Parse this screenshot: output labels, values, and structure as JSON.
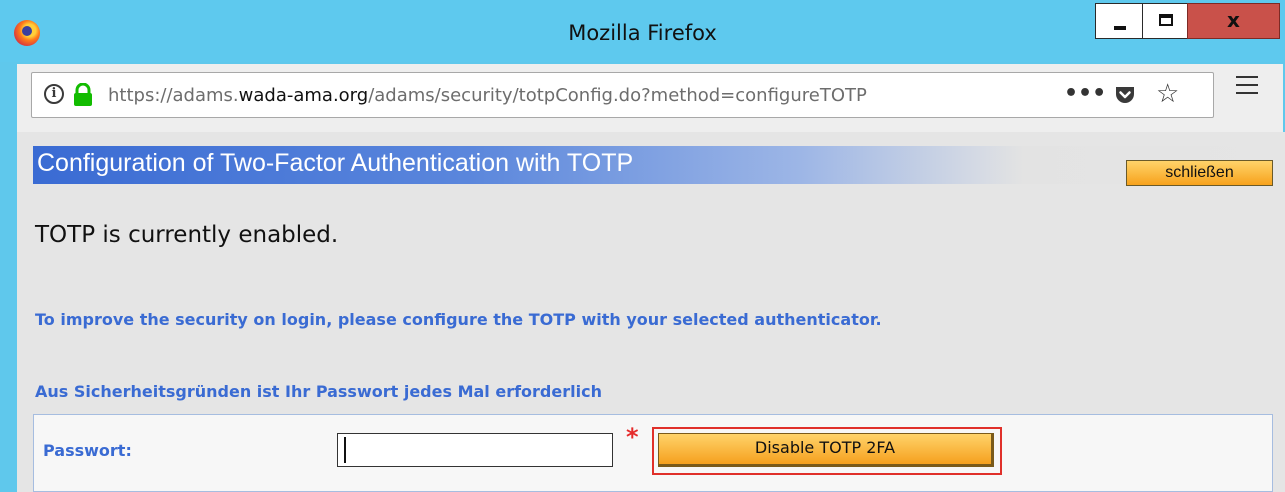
{
  "window": {
    "title": "Mozilla Firefox",
    "minimize_glyph": "",
    "close_glyph": "x"
  },
  "browser": {
    "url_prefix": "https://adams.",
    "url_domain": "wada-ama.org",
    "url_suffix": "/adams/security/totpConfig.do?method=configureTOTP",
    "more_glyph": "•••",
    "star_glyph": "☆"
  },
  "page": {
    "header_title": "Configuration of Two-Factor Authentication with TOTP",
    "close_button": "schließen",
    "status": "TOTP is currently enabled.",
    "info_configure": "To improve the security on login, please configure the TOTP with your selected authenticator.",
    "info_password": "Aus Sicherheitsgründen ist Ihr Passwort jedes Mal erforderlich",
    "password_label": "Passwort:",
    "password_value": "",
    "required_marker": "*",
    "disable_button": "Disable TOTP 2FA"
  },
  "colors": {
    "titlebar": "#5ec9ee",
    "close_window": "#c9514a",
    "header_blue": "#3a6bd3",
    "label_blue": "#3a6bd3",
    "button_orange": "#f7a21c",
    "required_red": "#e52b2b",
    "highlight_red": "#e0302a"
  }
}
